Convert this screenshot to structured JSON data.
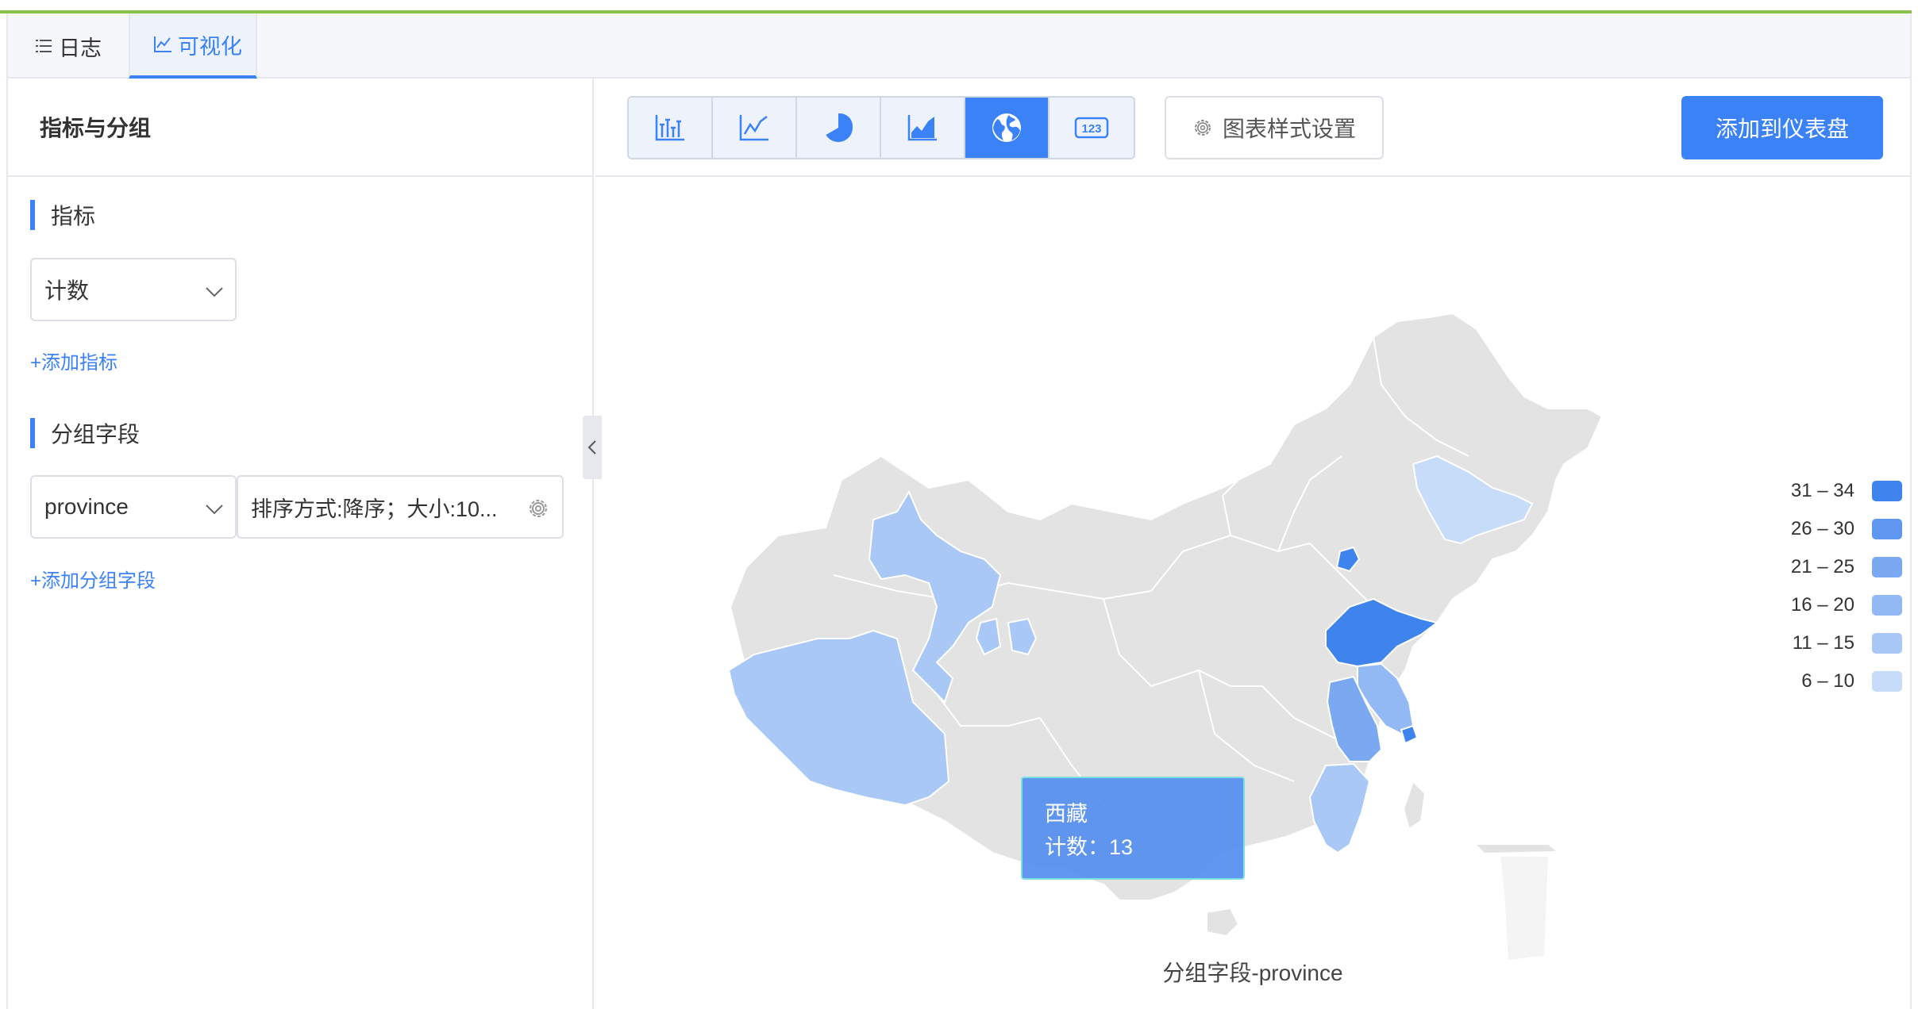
{
  "tabs": [
    {
      "label": "日志",
      "icon": "list-icon",
      "active": false
    },
    {
      "label": "可视化",
      "icon": "line-chart-icon",
      "active": true
    }
  ],
  "left_panel": {
    "title": "指标与分组",
    "metric_section": {
      "title": "指标",
      "selected": "计数",
      "add_label": "+添加指标"
    },
    "group_section": {
      "title": "分组字段",
      "selected": "province",
      "sort_text": "排序方式:降序；大小:10...",
      "add_label": "+添加分组字段"
    }
  },
  "toolbar": {
    "chart_types": [
      {
        "icon": "bar-chart-icon",
        "active": false
      },
      {
        "icon": "line-chart-icon",
        "active": false
      },
      {
        "icon": "pie-chart-icon",
        "active": false
      },
      {
        "icon": "area-chart-icon",
        "active": false
      },
      {
        "icon": "globe-map-icon",
        "active": true
      },
      {
        "icon": "number-123-icon",
        "active": false
      }
    ],
    "style_button": "图表样式设置",
    "add_dashboard_button": "添加到仪表盘"
  },
  "colors": {
    "accent": "#3b82f6",
    "map_base": "#e3e3e3",
    "scale": [
      "#c6dcf8",
      "#a9c8f6",
      "#92b9f4",
      "#7aa9f2",
      "#5f97f0",
      "#3f84ec"
    ]
  },
  "chart_data": {
    "type": "map",
    "metric": "计数",
    "group_by": "province",
    "title": "分组字段-province",
    "legend": [
      {
        "range": "31 – 34",
        "min": 31,
        "max": 34
      },
      {
        "range": "26 – 30",
        "min": 26,
        "max": 30
      },
      {
        "range": "21 – 25",
        "min": 21,
        "max": 25
      },
      {
        "range": "16 – 20",
        "min": 16,
        "max": 20
      },
      {
        "range": "11 – 15",
        "min": 11,
        "max": 15
      },
      {
        "range": "6 – 10",
        "min": 6,
        "max": 10
      }
    ],
    "tooltip": {
      "name": "西藏",
      "label": "计数",
      "value": 13
    }
  }
}
